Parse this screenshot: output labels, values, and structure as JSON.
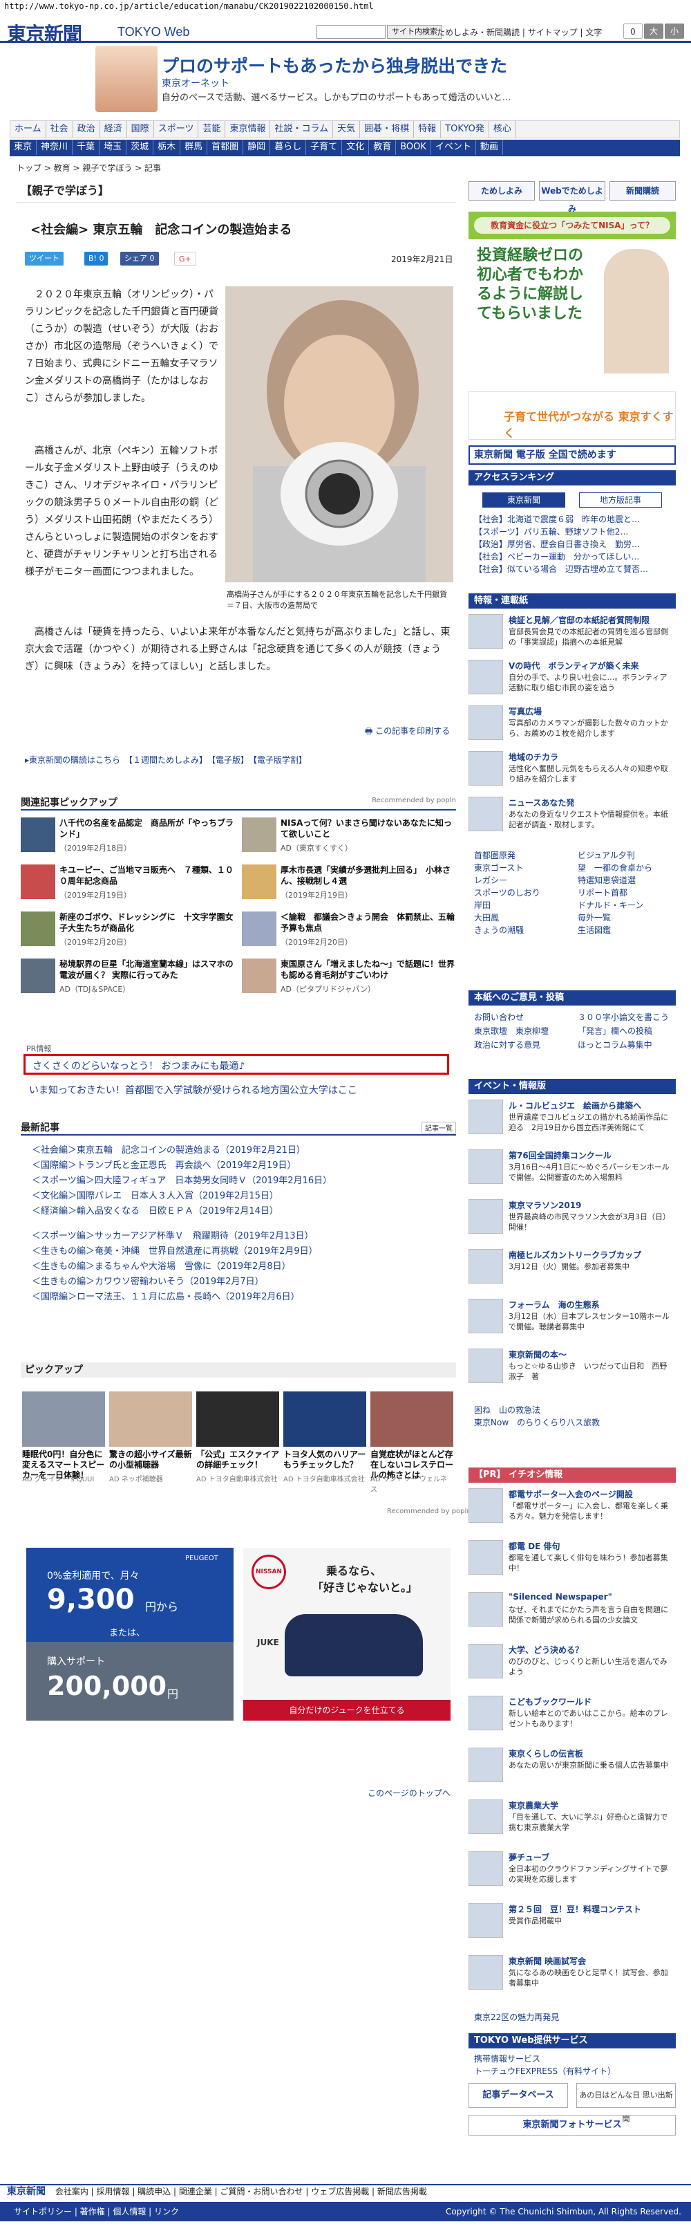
{
  "url": "http://www.tokyo-np.co.jp/article/education/manabu/CK2019022102000150.html",
  "header": {
    "logo": "東京新聞",
    "logo2": "TOKYO Web",
    "search_btn": "サイト内検索",
    "links": "ためしよみ・新聞購読 | サイトマップ | 文字",
    "size_big": "大",
    "size_small": "小",
    "size_zero": "0"
  },
  "banner": {
    "title": "プロのサポートもあったから独身脱出できた",
    "sub": "東京オーネット",
    "desc": "自分のペースで活動、選べるサービス。しかもプロのサポートもあって婚活のいいと…"
  },
  "nav1": [
    "ホーム",
    "社会",
    "政治",
    "経済",
    "国際",
    "スポーツ",
    "芸能",
    "東京情報",
    "社説・コラム",
    "天気",
    "囲碁・将棋",
    "特報",
    "TOKYO発",
    "核心"
  ],
  "nav2": [
    "東京",
    "神奈川",
    "千葉",
    "埼玉",
    "茨城",
    "栃木",
    "群馬",
    "首都圏",
    "静岡",
    "暮らし",
    "子育て",
    "文化",
    "教育",
    "BOOK",
    "イベント",
    "動画"
  ],
  "breadcrumb": "トップ > 教育 > 親子で学ぼう > 記事",
  "section": "【親子で学ぼう】",
  "article": {
    "title": "<社会編> 東京五輪　記念コインの製造始まる",
    "date": "2019年2月21日",
    "tweet": "ツイート",
    "b": "B! 0",
    "share": "シェア 0",
    "g": "G+",
    "p1": "２０２０年東京五輪（オリンピック）・パラリンピックを記念した千円銀貨と百円硬貨（こうか）の製造（せいぞう）が大阪（おおさか）市北区の造幣局（ぞうへいきょく）で７日始まり、式典にシドニー五輪女子マラソン金メダリストの高橋尚子（たかはしなおこ）さんらが参加しました。",
    "p2": "高橋さんが、北京（ペキン）五輪ソフトボール女子金メダリスト上野由岐子（うえのゆきこ）さん、リオデジャネイロ・パラリンピックの競泳男子５０メートル自由形の銅（どう）メダリスト山田拓朗（やまだたくろう）さんらといっしょに製造開始のボタンをおすと、硬貨がチャリンチャリンと打ち出される様子がモニター画面につつまれました。",
    "p3": "高橋さんは「硬貨を持ったら、いよいよ来年が本番なんだと気持ちが高ぶりました」と話し、東京大会で活躍（かつやく）が期待される上野さんは「記念硬貨を通じて多くの人が競技（きょうぎ）に興味（きょうみ）を持ってほしい」と話しました。",
    "caption": "高橋尚子さんが手にする２０２０年東京五輪を記念した千円銀貨＝７日、大阪市の造幣局で",
    "print": "この記事を印刷する"
  },
  "links1": "▸東京新聞の購読はこちら　【１週間ためしよみ】　【電子版】　【電子版学割】",
  "pickup_head": "関連記事ピックアップ",
  "recommended": "Recommended by popIn",
  "rec": [
    {
      "t": "八千代の名産を品認定　商品所が「やっちブランド」",
      "d": "（2019年2月18日）"
    },
    {
      "t": "NISAって何？いまさら聞けないあなたに知って欲しいこと",
      "d": "AD（東京すくすく）"
    },
    {
      "t": "キユーピー、ご当地マヨ販売へ　７種類、１００周年記念商品",
      "d": "（2019年2月19日）"
    },
    {
      "t": "厚木市長選「実績が多選批判上回る」　小林さん、接戦制し４選",
      "d": "（2019年2月19日）"
    },
    {
      "t": "新座のゴボウ、ドレッシングに　十文字学園女子大生たちが商品化",
      "d": "（2019年2月20日）"
    },
    {
      "t": "＜論戦　都議会＞きょう開会　体罰禁止、五輪予算も焦点",
      "d": "（2019年2月20日）"
    },
    {
      "t": "秘境駅界の巨星「北海道室蘭本線」はスマホの電波が届く？ 実際に行ってみた",
      "d": "AD（TDJ＆SPACE）"
    },
    {
      "t": "東国原さん「増えましたね～」で話題に！世界も認める育毛剤がすごいわけ",
      "d": "AD（ピタプリドジャパン）"
    }
  ],
  "pr": "PR情報",
  "pr_box": "さくさくのどらいなっとう！ おつまみにも最適♪",
  "pr_line": "いま知っておきたい！首都圏で入学試験が受けられる地方国公立大学はここ",
  "latest_head": "最新記事",
  "latest_more": "記事一覧",
  "latest": [
    "＜社会編＞東京五輪　記念コインの製造始まる（2019年2月21日）",
    "＜国際編＞トランプ氏と金正恩氏　再会談へ（2019年2月19日）",
    "＜スポーツ編＞四大陸フィギュア　日本勢男女同時Ｖ（2019年2月16日）",
    "＜文化編＞国際バレエ　日本人３人入賞（2019年2月15日）",
    "＜経済編＞輸入品安くなる　日欧ＥＰＡ（2019年2月14日）",
    "＜スポーツ編＞サッカーアジア杯準Ｖ　飛躍期待（2019年2月13日）",
    "＜生きもの編＞奄美・沖縄　世界自然遺産に再挑戦（2019年2月9日）",
    "＜生きもの編＞まるちゃんや大浴場　雪像に（2019年2月8日）",
    "＜生きもの編＞カワウソ密輸わいそう（2019年2月7日）",
    "＜国際編＞ローマ法王、１１月に広島・長崎へ（2019年2月6日）"
  ],
  "pickup2_head": "ピックアップ",
  "pickup2": [
    {
      "t": "睡眠代0円！自分色に変えるスマートスピーカーを一日体験！",
      "a": "AD グレイシー's QUUI"
    },
    {
      "t": "驚きの超小サイズ最新の小型補聴器",
      "a": "AD ネッポ補聴器"
    },
    {
      "t": "「公式」エスクァイアの詳細チェック！",
      "a": "AD トヨタ自動車株式会社"
    },
    {
      "t": "トヨタ人気のハリアーもうチェックした？",
      "a": "AD トヨタ自動車株式会社"
    },
    {
      "t": "自覚症状がほとんど存在しないコレステロールの怖さとは",
      "a": "AD サントリー ウェルネス"
    }
  ],
  "pickup2_rec": "Recommended by popIn",
  "ad1": {
    "l1": "0%金利適用で、月々",
    "l2": "9,300",
    "l3": "円から",
    "l4": "または、",
    "l5": "購入サポート",
    "l6": "200,000",
    "l7": "円",
    "brand": "PEUGEOT"
  },
  "ad2": {
    "l1": "乗るなら、",
    "l2": "「好きじゃないと。」",
    "brand": "NISSAN",
    "model": "JUKE",
    "cta": "自分だけのジュークを仕立てる"
  },
  "tomore": "このページのトップへ",
  "side": {
    "top_btns": [
      "ためしよみ",
      "Webでためしよみ",
      "新聞購読"
    ],
    "nisa_head": "教育資金に役立つ「つみたてNISA」って？",
    "nisa_body": "投資経験ゼロの初心者でもわかるように解説してもらいました",
    "sukusuku": "子育て世代がつながる 東京すくすく",
    "denshi": "東京新聞 電子版 全国で読めます",
    "access_head": "アクセスランキング",
    "access_tabs": [
      "東京新聞",
      "地方版記事"
    ],
    "access": [
      "【社会】北海道で震度６弱　昨年の地震と…",
      "【スポーツ】パリ五輪、野球ソフト他2…",
      "【政治】厚労省、歴会自日書き換え　勤労…",
      "【社会】ベビーカー運動　分かってほしい…",
      "【社会】似ている場合　辺野古埋め立て賛否…"
    ],
    "tokuho_head": "特報・連載紙",
    "items": [
      {
        "t": "検証と見解／官邸の本紙記者質問制限",
        "d": "官邸長質会見での本紙記者の質問を巡る官邸側の「事実誤認」指摘への本紙見解"
      },
      {
        "t": "Vの時代　ボランティアが築く未来",
        "d": "自分の手で、より良い社会に…。ボランティア活動に取り組む市民の姿を追う"
      },
      {
        "t": "写真広場",
        "d": "写真部のカメラマンが撮影した数々のカットから、お薦めの１枚を紹介します"
      },
      {
        "t": "地域のチカラ",
        "d": "活性化へ奮闘し元気をもらえる人々の知恵や取り組みを紹介します"
      },
      {
        "t": "ニュースあなた発",
        "d": "あなたの身近なリクエストや情報提供を。本紙記者が調査・取材します。"
      }
    ],
    "mini": [
      "首都圏原発",
      "ビジュアル夕刊",
      "東京ゴースト",
      "望　一都の食卓から",
      "レガシー",
      "特選知恵袋道選",
      "スポーツのしおり",
      "リポート首都",
      "岸田",
      "ドナルド・キーン",
      "大田鳳",
      "毎外一覧",
      "きょうの潮騒",
      "生活図鑑"
    ],
    "opinion_head": "本紙へのご意見・投稿",
    "opinion": [
      "お問い合わせ",
      "３００字小論文を書こう",
      "東京歌壇　東京柳壇",
      "「発言」欄への投稿",
      "政治に対する意見",
      "ほっとコラム募集中"
    ],
    "event_head": "イベント・情報版",
    "events": [
      {
        "t": "ル・コルビュジエ　絵画から建築へ",
        "d": "世界遺産でコルビュジエの描かれる絵画作品に迫る　2月19日から国立西洋美術館にて"
      },
      {
        "t": "第76回全国詩集コンクール",
        "d": "3月16日〜4月1日に～めぐろパーシモンホールで開催。公開審査のため入場無料"
      },
      {
        "t": "東京マラソン2019",
        "d": "世界最高峰の市民マラソン大会が3月3日（日）開催！"
      },
      {
        "t": "南極ヒルズカントリークラブカップ",
        "d": "3月12日（火）開催。参加者募集中"
      },
      {
        "t": "フォーラム　海の生態系",
        "d": "3月12日（水）日本プレスセンター10階ホールで開催。聴講者募集中"
      },
      {
        "t": "東京新聞の本～",
        "d": "もっと☆ゆる山歩き　いつだって山日和　西野淑子　著"
      }
    ],
    "ev_more": [
      "困ね　山の救急法",
      "東京Now　のらりくらり八ス旅教"
    ],
    "pr_head": "【PR】 イチオシ情報",
    "pr_items": [
      {
        "t": "都電サポーター入会のページ開設",
        "d": "「都電サポーター」に入会し、都電を楽しく乗る方々。魅力を発信します！"
      },
      {
        "t": "都電 DE 俳句",
        "d": "都電を通して楽しく俳句を味わう！参加者募集中！"
      },
      {
        "t": "\"Silenced Newspaper\"",
        "d": "なぜ、それまでにかたう声を言う自由を問題に関係で新聞が求められる国の少女論文"
      },
      {
        "t": "大学、どう決める？",
        "d": "のびのびと、じっくりと新しい生活を選んでみよう"
      },
      {
        "t": "こどもブックワールド",
        "d": "新しい絵本とのであいはここから。絵本のプレゼントもあります！"
      },
      {
        "t": "東京くらしの伝言板",
        "d": "あなたの思いが東京新聞に乗る個人広告募集中"
      },
      {
        "t": "東京農業大学",
        "d": "「目を通して、大いに学ぶ」好奇心と遠智力で挑む東京農業大学"
      },
      {
        "t": "夢チューブ",
        "d": "全日本初のクラウドファンディングサイトで夢の実現を応援します"
      },
      {
        "t": "第２５回　豆！豆！料理コンテスト",
        "d": "受賞作品掲載中"
      },
      {
        "t": "東京新聞 映画試写会",
        "d": "気になるあの映画をひと足早く！試写会、参加者募集中"
      }
    ],
    "charm": "東京22区の魅力再発見",
    "tokyoweb_head": "TOKYO Web提供サービス",
    "tokyoweb": [
      "携帯情報サービス",
      "トーチュウFEXPRESS（有料サイト）"
    ],
    "db": "記事データベース",
    "photo": "東京新聞フォトサービス",
    "omoide": "あの日はどんな日 思い出新聞"
  },
  "footer": {
    "logo": "東京新聞",
    "links": "会社案内 | 採用情報 | 購読申込 | 関連企業 | ご質問・お問い合わせ | ウェブ広告掲載 | 新聞広告掲載",
    "links2": "サイトポリシー | 著作権 | 個人情報 | リンク",
    "copy": "Copyright © The Chunichi Shimbun, All Rights Reserved."
  }
}
